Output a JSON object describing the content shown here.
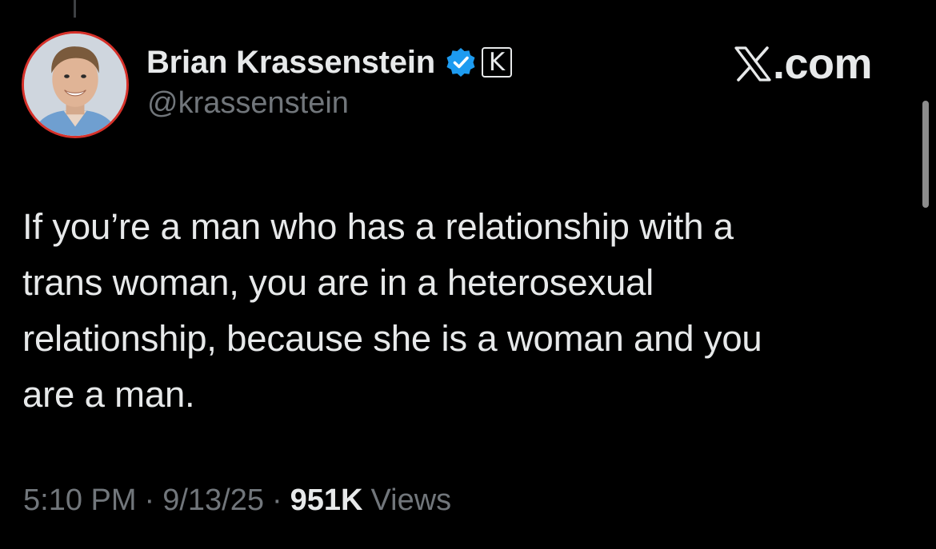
{
  "author": {
    "display_name": "Brian Krassenstein",
    "handle": "@krassenstein",
    "verified_icon": "verified-badge-icon",
    "affiliate_badge": "K",
    "avatar_icon": "profile-photo"
  },
  "watermark": {
    "logo_icon": "x-logo-icon",
    "text": ".com"
  },
  "post": {
    "text_lines": [
      "If you’re a man who has a relationship with a",
      "trans woman, you are in a heterosexual",
      "relationship, because she is a woman and you",
      "are a man."
    ]
  },
  "meta": {
    "time": "5:10 PM",
    "date": "9/13/25",
    "separator": "·",
    "views_count": "951K",
    "views_label": "Views"
  },
  "colors": {
    "background": "#000000",
    "primary_text": "#e7e9ea",
    "secondary_text": "#71767b",
    "verified_blue": "#1d9bf0",
    "avatar_ring": "#d6312a"
  }
}
